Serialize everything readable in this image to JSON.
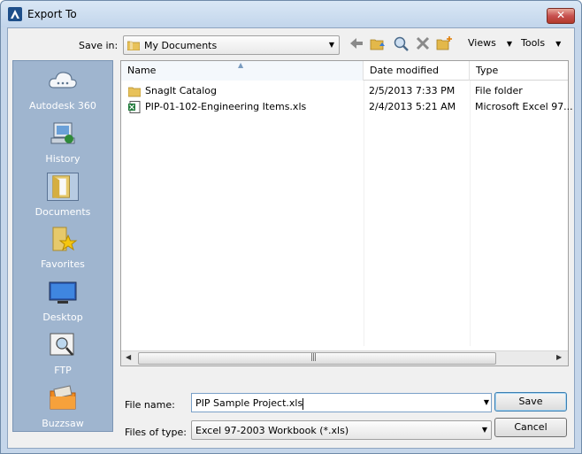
{
  "window": {
    "title": "Export To",
    "close_glyph": "✕"
  },
  "toolbar": {
    "save_in_label": "Save in:",
    "save_in_value": "My Documents",
    "icons": [
      "back-icon",
      "up-folder-icon",
      "search-web-icon",
      "delete-icon",
      "new-folder-icon"
    ],
    "views_label": "Views",
    "tools_label": "Tools"
  },
  "places": [
    {
      "label": "Autodesk 360",
      "icon": "cloud-icon"
    },
    {
      "label": "History",
      "icon": "history-icon"
    },
    {
      "label": "Documents",
      "icon": "documents-icon",
      "selected": true
    },
    {
      "label": "Favorites",
      "icon": "favorites-icon"
    },
    {
      "label": "Desktop",
      "icon": "desktop-icon"
    },
    {
      "label": "FTP",
      "icon": "ftp-icon"
    },
    {
      "label": "Buzzsaw",
      "icon": "buzzsaw-icon"
    }
  ],
  "filelist": {
    "columns": [
      "Name",
      "Date modified",
      "Type"
    ],
    "rows": [
      {
        "name": "SnagIt Catalog",
        "date": "2/5/2013 7:33 PM",
        "type": "File folder",
        "icon": "folder-icon"
      },
      {
        "name": "PIP-01-102-Engineering Items.xls",
        "date": "2/4/2013 5:21 AM",
        "type": "Microsoft Excel 97...",
        "icon": "excel-file-icon"
      }
    ]
  },
  "bottom": {
    "file_name_label": "File name:",
    "file_name_value": "PIP Sample Project.xls",
    "file_type_label": "Files of type:",
    "file_type_value": "Excel 97-2003 Workbook (*.xls)",
    "save_label": "Save",
    "cancel_label": "Cancel"
  },
  "colors": {
    "places_bg": "#9fb5cf",
    "frame": "#c5d6ea",
    "close": "#c75050"
  }
}
